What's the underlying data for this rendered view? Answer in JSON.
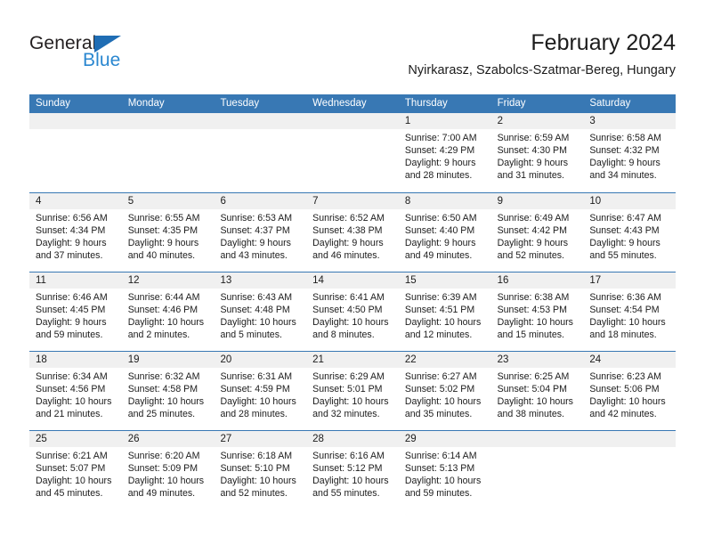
{
  "brand": {
    "name_top": "General",
    "name_bottom": "Blue",
    "triangle_color": "#1f6db4",
    "text_color": "#231f20",
    "blue_color": "#2a87d0"
  },
  "header": {
    "title": "February 2024",
    "subtitle": "Nyirkarasz, Szabolcs-Szatmar-Bereg, Hungary"
  },
  "theme": {
    "header_bg": "#3878b4",
    "header_text": "#ffffff",
    "daynum_bg": "#f0f0f0",
    "cell_bg": "#ffffff",
    "rule_color": "#3878b4",
    "body_text": "#1c1c1c"
  },
  "weekday_headers": [
    "Sunday",
    "Monday",
    "Tuesday",
    "Wednesday",
    "Thursday",
    "Friday",
    "Saturday"
  ],
  "weeks": [
    [
      {
        "day": "",
        "lines": [
          "",
          "",
          "",
          ""
        ]
      },
      {
        "day": "",
        "lines": [
          "",
          "",
          "",
          ""
        ]
      },
      {
        "day": "",
        "lines": [
          "",
          "",
          "",
          ""
        ]
      },
      {
        "day": "",
        "lines": [
          "",
          "",
          "",
          ""
        ]
      },
      {
        "day": "1",
        "lines": [
          "Sunrise: 7:00 AM",
          "Sunset: 4:29 PM",
          "Daylight: 9 hours",
          "and 28 minutes."
        ]
      },
      {
        "day": "2",
        "lines": [
          "Sunrise: 6:59 AM",
          "Sunset: 4:30 PM",
          "Daylight: 9 hours",
          "and 31 minutes."
        ]
      },
      {
        "day": "3",
        "lines": [
          "Sunrise: 6:58 AM",
          "Sunset: 4:32 PM",
          "Daylight: 9 hours",
          "and 34 minutes."
        ]
      }
    ],
    [
      {
        "day": "4",
        "lines": [
          "Sunrise: 6:56 AM",
          "Sunset: 4:34 PM",
          "Daylight: 9 hours",
          "and 37 minutes."
        ]
      },
      {
        "day": "5",
        "lines": [
          "Sunrise: 6:55 AM",
          "Sunset: 4:35 PM",
          "Daylight: 9 hours",
          "and 40 minutes."
        ]
      },
      {
        "day": "6",
        "lines": [
          "Sunrise: 6:53 AM",
          "Sunset: 4:37 PM",
          "Daylight: 9 hours",
          "and 43 minutes."
        ]
      },
      {
        "day": "7",
        "lines": [
          "Sunrise: 6:52 AM",
          "Sunset: 4:38 PM",
          "Daylight: 9 hours",
          "and 46 minutes."
        ]
      },
      {
        "day": "8",
        "lines": [
          "Sunrise: 6:50 AM",
          "Sunset: 4:40 PM",
          "Daylight: 9 hours",
          "and 49 minutes."
        ]
      },
      {
        "day": "9",
        "lines": [
          "Sunrise: 6:49 AM",
          "Sunset: 4:42 PM",
          "Daylight: 9 hours",
          "and 52 minutes."
        ]
      },
      {
        "day": "10",
        "lines": [
          "Sunrise: 6:47 AM",
          "Sunset: 4:43 PM",
          "Daylight: 9 hours",
          "and 55 minutes."
        ]
      }
    ],
    [
      {
        "day": "11",
        "lines": [
          "Sunrise: 6:46 AM",
          "Sunset: 4:45 PM",
          "Daylight: 9 hours",
          "and 59 minutes."
        ]
      },
      {
        "day": "12",
        "lines": [
          "Sunrise: 6:44 AM",
          "Sunset: 4:46 PM",
          "Daylight: 10 hours",
          "and 2 minutes."
        ]
      },
      {
        "day": "13",
        "lines": [
          "Sunrise: 6:43 AM",
          "Sunset: 4:48 PM",
          "Daylight: 10 hours",
          "and 5 minutes."
        ]
      },
      {
        "day": "14",
        "lines": [
          "Sunrise: 6:41 AM",
          "Sunset: 4:50 PM",
          "Daylight: 10 hours",
          "and 8 minutes."
        ]
      },
      {
        "day": "15",
        "lines": [
          "Sunrise: 6:39 AM",
          "Sunset: 4:51 PM",
          "Daylight: 10 hours",
          "and 12 minutes."
        ]
      },
      {
        "day": "16",
        "lines": [
          "Sunrise: 6:38 AM",
          "Sunset: 4:53 PM",
          "Daylight: 10 hours",
          "and 15 minutes."
        ]
      },
      {
        "day": "17",
        "lines": [
          "Sunrise: 6:36 AM",
          "Sunset: 4:54 PM",
          "Daylight: 10 hours",
          "and 18 minutes."
        ]
      }
    ],
    [
      {
        "day": "18",
        "lines": [
          "Sunrise: 6:34 AM",
          "Sunset: 4:56 PM",
          "Daylight: 10 hours",
          "and 21 minutes."
        ]
      },
      {
        "day": "19",
        "lines": [
          "Sunrise: 6:32 AM",
          "Sunset: 4:58 PM",
          "Daylight: 10 hours",
          "and 25 minutes."
        ]
      },
      {
        "day": "20",
        "lines": [
          "Sunrise: 6:31 AM",
          "Sunset: 4:59 PM",
          "Daylight: 10 hours",
          "and 28 minutes."
        ]
      },
      {
        "day": "21",
        "lines": [
          "Sunrise: 6:29 AM",
          "Sunset: 5:01 PM",
          "Daylight: 10 hours",
          "and 32 minutes."
        ]
      },
      {
        "day": "22",
        "lines": [
          "Sunrise: 6:27 AM",
          "Sunset: 5:02 PM",
          "Daylight: 10 hours",
          "and 35 minutes."
        ]
      },
      {
        "day": "23",
        "lines": [
          "Sunrise: 6:25 AM",
          "Sunset: 5:04 PM",
          "Daylight: 10 hours",
          "and 38 minutes."
        ]
      },
      {
        "day": "24",
        "lines": [
          "Sunrise: 6:23 AM",
          "Sunset: 5:06 PM",
          "Daylight: 10 hours",
          "and 42 minutes."
        ]
      }
    ],
    [
      {
        "day": "25",
        "lines": [
          "Sunrise: 6:21 AM",
          "Sunset: 5:07 PM",
          "Daylight: 10 hours",
          "and 45 minutes."
        ]
      },
      {
        "day": "26",
        "lines": [
          "Sunrise: 6:20 AM",
          "Sunset: 5:09 PM",
          "Daylight: 10 hours",
          "and 49 minutes."
        ]
      },
      {
        "day": "27",
        "lines": [
          "Sunrise: 6:18 AM",
          "Sunset: 5:10 PM",
          "Daylight: 10 hours",
          "and 52 minutes."
        ]
      },
      {
        "day": "28",
        "lines": [
          "Sunrise: 6:16 AM",
          "Sunset: 5:12 PM",
          "Daylight: 10 hours",
          "and 55 minutes."
        ]
      },
      {
        "day": "29",
        "lines": [
          "Sunrise: 6:14 AM",
          "Sunset: 5:13 PM",
          "Daylight: 10 hours",
          "and 59 minutes."
        ]
      },
      {
        "day": "",
        "lines": [
          "",
          "",
          "",
          ""
        ]
      },
      {
        "day": "",
        "lines": [
          "",
          "",
          "",
          ""
        ]
      }
    ]
  ]
}
